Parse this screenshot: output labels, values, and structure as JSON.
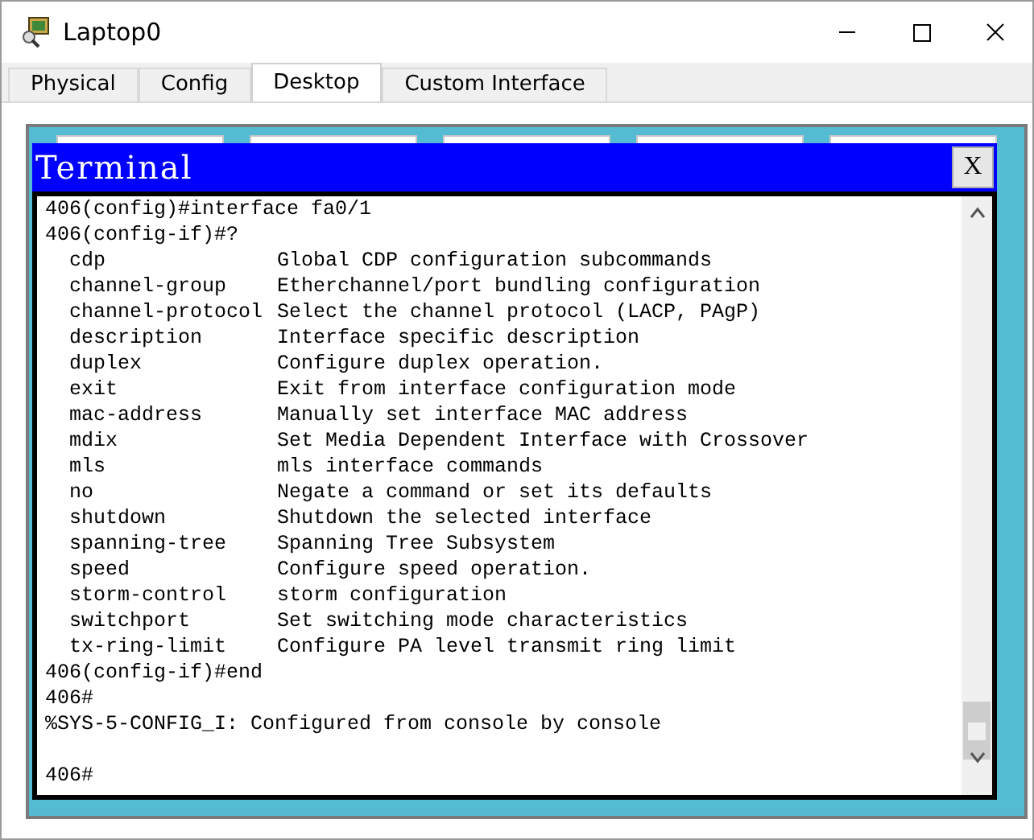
{
  "window": {
    "title": "Laptop0"
  },
  "tabs": [
    {
      "label": "Physical",
      "selected": false
    },
    {
      "label": "Config",
      "selected": false
    },
    {
      "label": "Desktop",
      "selected": true
    },
    {
      "label": "Custom Interface",
      "selected": false
    }
  ],
  "terminal": {
    "title": "Terminal",
    "close": "X",
    "lines": [
      {
        "kind": "prompt",
        "text": "406(config)#interface fa0/1"
      },
      {
        "kind": "prompt",
        "text": "406(config-if)#?"
      },
      {
        "kind": "help",
        "command": "cdp",
        "description": "Global CDP configuration subcommands"
      },
      {
        "kind": "help",
        "command": "channel-group",
        "description": "Etherchannel/port bundling configuration"
      },
      {
        "kind": "help",
        "command": "channel-protocol",
        "description": "Select the channel protocol (LACP, PAgP)"
      },
      {
        "kind": "help",
        "command": "description",
        "description": "Interface specific description"
      },
      {
        "kind": "help",
        "command": "duplex",
        "description": "Configure duplex operation."
      },
      {
        "kind": "help",
        "command": "exit",
        "description": "Exit from interface configuration mode"
      },
      {
        "kind": "help",
        "command": "mac-address",
        "description": "Manually set interface MAC address"
      },
      {
        "kind": "help",
        "command": "mdix",
        "description": "Set Media Dependent Interface with Crossover"
      },
      {
        "kind": "help",
        "command": "mls",
        "description": "mls interface commands"
      },
      {
        "kind": "help",
        "command": "no",
        "description": "Negate a command or set its defaults"
      },
      {
        "kind": "help",
        "command": "shutdown",
        "description": "Shutdown the selected interface"
      },
      {
        "kind": "help",
        "command": "spanning-tree",
        "description": "Spanning Tree Subsystem"
      },
      {
        "kind": "help",
        "command": "speed",
        "description": "Configure speed operation."
      },
      {
        "kind": "help",
        "command": "storm-control",
        "description": "storm configuration"
      },
      {
        "kind": "help",
        "command": "switchport",
        "description": "Set switching mode characteristics"
      },
      {
        "kind": "help",
        "command": "tx-ring-limit",
        "description": "Configure PA level transmit ring limit"
      },
      {
        "kind": "prompt",
        "text": "406(config-if)#end"
      },
      {
        "kind": "prompt",
        "text": "406#"
      },
      {
        "kind": "prompt",
        "text": "%SYS-5-CONFIG_I: Configured from console by console"
      },
      {
        "kind": "blank"
      },
      {
        "kind": "prompt",
        "text": "406#"
      }
    ]
  }
}
